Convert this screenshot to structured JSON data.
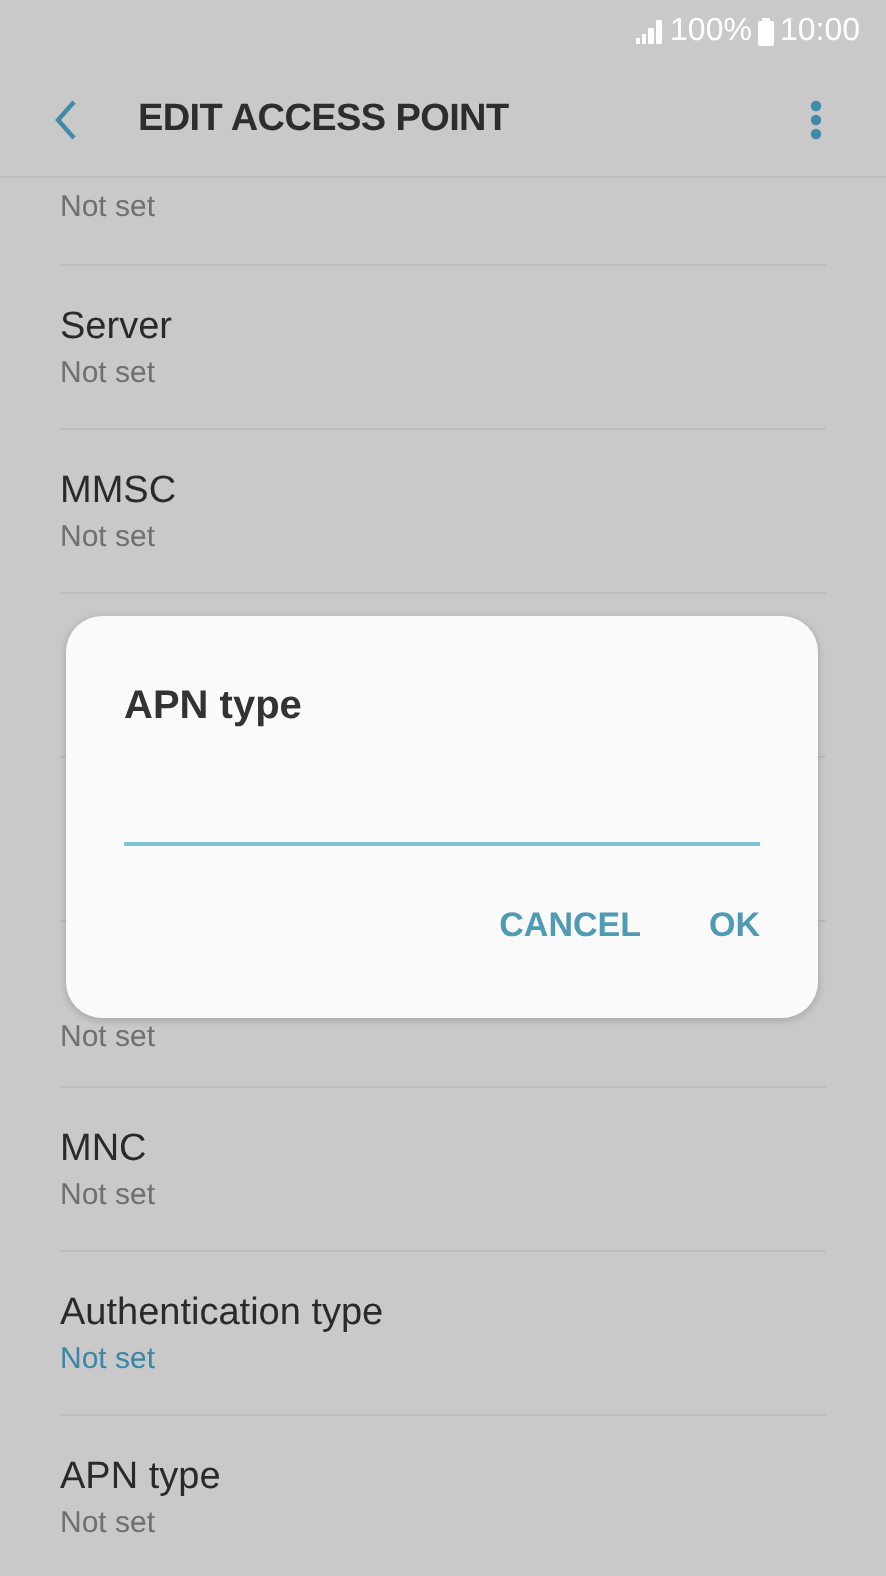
{
  "status_bar": {
    "battery": "100%",
    "time": "10:00"
  },
  "header": {
    "title": "EDIT ACCESS POINT"
  },
  "rows": [
    {
      "kind": "cut",
      "value": "Not set",
      "highlighted": false
    },
    {
      "kind": "full",
      "title": "Server",
      "value": "Not set",
      "highlighted": false
    },
    {
      "kind": "full",
      "title": "MMSC",
      "value": "Not set",
      "highlighted": false
    },
    {
      "kind": "covered"
    },
    {
      "kind": "covered"
    },
    {
      "kind": "cut",
      "value": "Not set",
      "highlighted": false
    },
    {
      "kind": "full",
      "title": "MNC",
      "value": "Not set",
      "highlighted": false
    },
    {
      "kind": "full",
      "title": "Authentication type",
      "value": "Not set",
      "highlighted": true
    },
    {
      "kind": "full",
      "title": "APN type",
      "value": "Not set",
      "highlighted": false
    }
  ],
  "dialog": {
    "title": "APN type",
    "buttons": [
      "CANCEL",
      "OK"
    ]
  }
}
